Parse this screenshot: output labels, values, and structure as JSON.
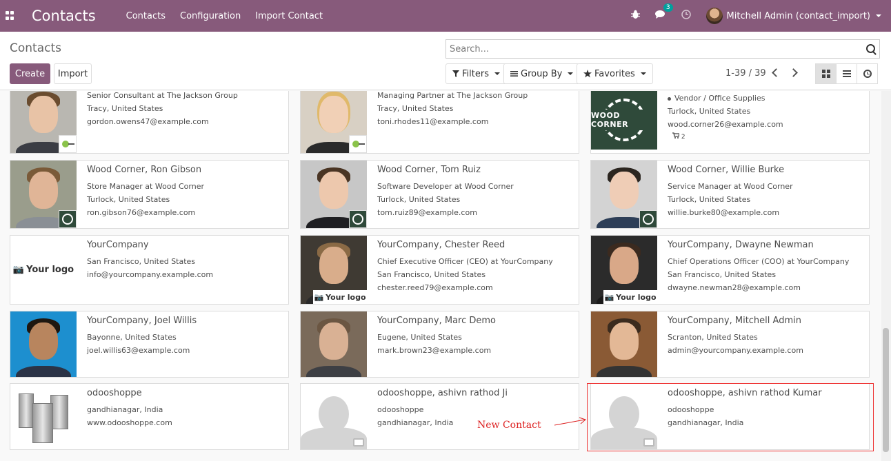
{
  "navbar": {
    "brand": "Contacts",
    "menu": [
      "Contacts",
      "Configuration",
      "Import Contact"
    ],
    "chat_count": "3",
    "user": "Mitchell Admin (contact_import)"
  },
  "control": {
    "breadcrumb": "Contacts",
    "create_label": "Create",
    "import_label": "Import",
    "search_placeholder": "Search...",
    "filters_label": "Filters",
    "groupby_label": "Group By",
    "favorites_label": "Favorites",
    "pager": "1-39 / 39"
  },
  "cards": [
    {
      "name": "",
      "lines": [
        "Senior Consultant at The Jackson Group",
        "Tracy, United States",
        "gordon.owens47@example.com"
      ]
    },
    {
      "name": "",
      "lines": [
        "Managing Partner at The Jackson Group",
        "Tracy, United States",
        "toni.rhodes11@example.com"
      ]
    },
    {
      "name": "",
      "lines": [
        "Vendor / Office Supplies",
        "Turlock, United States",
        "wood.corner26@example.com"
      ],
      "cart": "2"
    },
    {
      "name": "Wood Corner, Ron Gibson",
      "lines": [
        "Store Manager at Wood Corner",
        "Turlock, United States",
        "ron.gibson76@example.com"
      ]
    },
    {
      "name": "Wood Corner, Tom Ruiz",
      "lines": [
        "Software Developer at Wood Corner",
        "Turlock, United States",
        "tom.ruiz89@example.com"
      ]
    },
    {
      "name": "Wood Corner, Willie Burke",
      "lines": [
        "Service Manager at Wood Corner",
        "Turlock, United States",
        "willie.burke80@example.com"
      ]
    },
    {
      "name": "YourCompany",
      "lines": [
        "San Francisco, United States",
        "info@yourcompany.example.com"
      ]
    },
    {
      "name": "YourCompany, Chester Reed",
      "lines": [
        "Chief Executive Officer (CEO) at YourCompany",
        "San Francisco, United States",
        "chester.reed79@example.com"
      ]
    },
    {
      "name": "YourCompany, Dwayne Newman",
      "lines": [
        "Chief Operations Officer (COO) at YourCompany",
        "San Francisco, United States",
        "dwayne.newman28@example.com"
      ]
    },
    {
      "name": "YourCompany, Joel Willis",
      "lines": [
        "Bayonne, United States",
        "joel.willis63@example.com"
      ]
    },
    {
      "name": "YourCompany, Marc Demo",
      "lines": [
        "Eugene, United States",
        "mark.brown23@example.com"
      ]
    },
    {
      "name": "YourCompany, Mitchell Admin",
      "lines": [
        "Scranton, United States",
        "admin@yourcompany.example.com"
      ]
    },
    {
      "name": "odooshoppe",
      "lines": [
        "gandhianagar, India",
        "www.odooshoppe.com"
      ]
    },
    {
      "name": "odooshoppe, ashivn rathod Ji",
      "lines": [
        "odooshoppe",
        "gandhianagar, India"
      ]
    },
    {
      "name": "odooshoppe, ashivn rathod Kumar",
      "lines": [
        "odooshoppe",
        "gandhianagar, India"
      ]
    }
  ],
  "logos": {
    "wood_corner": "WOOD CORNER",
    "your_logo": "Your logo"
  },
  "annotation": "New  Contact"
}
